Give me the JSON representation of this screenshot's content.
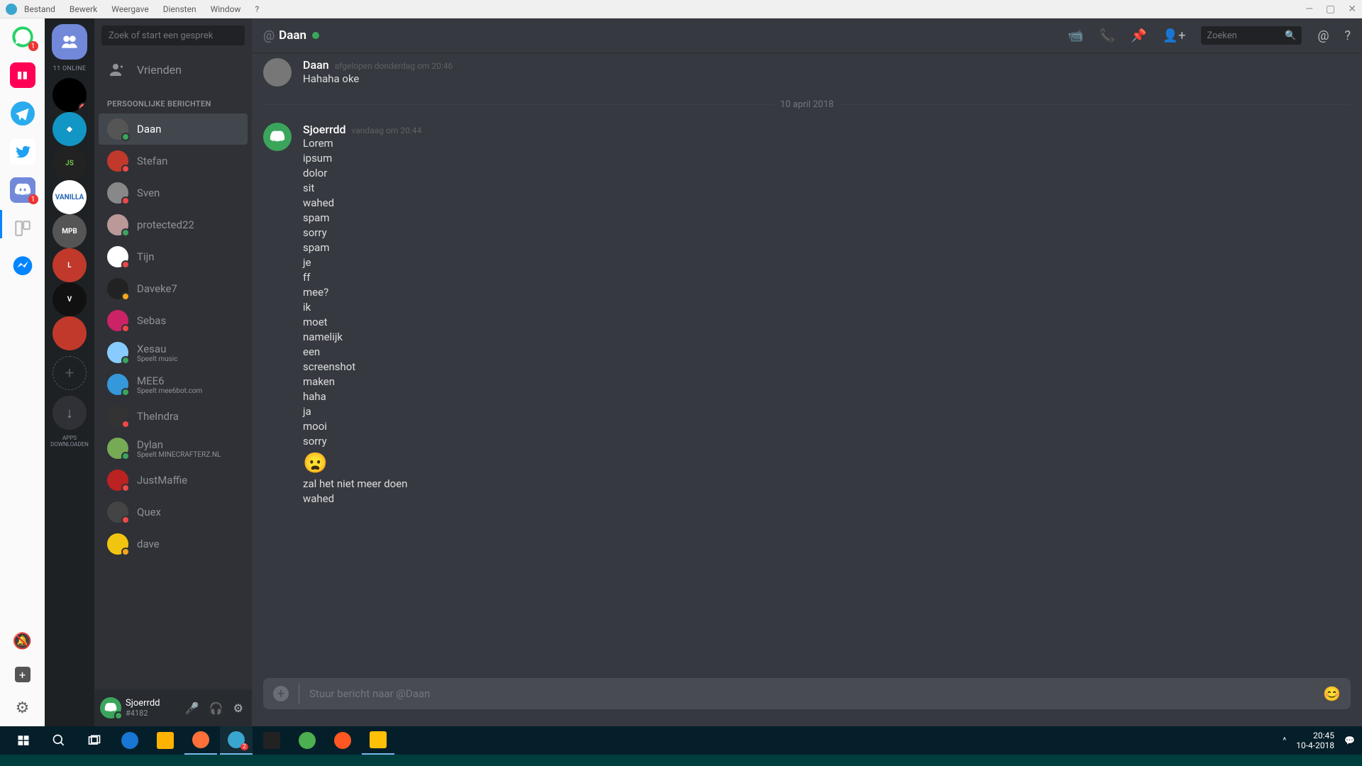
{
  "titlebar": {
    "menus": [
      "Bestand",
      "Bewerk",
      "Weergave",
      "Diensten",
      "Window",
      "?"
    ]
  },
  "rail": {
    "items": [
      {
        "name": "whatsapp",
        "glyph": "🟢",
        "bg": "#fff",
        "badge": "1",
        "svgColor": "#25d366"
      },
      {
        "name": "deezer",
        "glyph": "▮▮",
        "bg": "#ff0055",
        "badge": null
      },
      {
        "name": "telegram",
        "glyph": "➤",
        "bg": "#2aabee",
        "badge": null
      },
      {
        "name": "twitter",
        "glyph": "🐦",
        "bg": "#fff",
        "badge": null
      },
      {
        "name": "discord",
        "glyph": "🎮",
        "bg": "#7289da",
        "badge": "1",
        "active": true
      },
      {
        "name": "trello",
        "glyph": "▭",
        "bg": "#fff",
        "badge": null
      },
      {
        "name": "messenger",
        "glyph": "💬",
        "bg": "#fff",
        "badge": null
      }
    ]
  },
  "servers": {
    "home_online": "11 ONLINE",
    "list": [
      {
        "name": "server-1",
        "bg": "#000",
        "glyph": "",
        "badge": "2",
        "img": true
      },
      {
        "name": "server-2",
        "bg": "#1296c5",
        "glyph": "◆",
        "badge": null
      },
      {
        "name": "server-3",
        "bg": "#222",
        "glyph": "JS",
        "badge": null,
        "color": "#6cc24a"
      },
      {
        "name": "server-4",
        "bg": "#fff",
        "glyph": "VANILLA",
        "badge": null,
        "color": "#2264b5"
      },
      {
        "name": "server-5",
        "bg": "#555",
        "glyph": "MPB",
        "badge": null,
        "color": "#fff"
      },
      {
        "name": "server-6",
        "bg": "#c0392b",
        "glyph": "L",
        "badge": null
      },
      {
        "name": "server-7",
        "bg": "#111",
        "glyph": "V",
        "badge": null,
        "color": "#fff"
      },
      {
        "name": "server-8",
        "bg": "#c0392b",
        "glyph": "",
        "badge": null
      }
    ],
    "download_label": "APPS\nDOWNLOADEN"
  },
  "dm": {
    "search_placeholder": "Zoek of start een gesprek",
    "friends_label": "Vrienden",
    "section_label": "PERSOONLIJKE BERICHTEN",
    "items": [
      {
        "name": "Daan",
        "status": "online",
        "active": true,
        "bg": "#555"
      },
      {
        "name": "Stefan",
        "status": "dnd",
        "bg": "#c0392b"
      },
      {
        "name": "Sven",
        "status": "dnd",
        "bg": "#888"
      },
      {
        "name": "protected22",
        "status": "online",
        "bg": "#b99"
      },
      {
        "name": "Tijn",
        "status": "dnd",
        "bg": "#fff"
      },
      {
        "name": "Daveke7",
        "status": "idle",
        "bg": "#222"
      },
      {
        "name": "Sebas",
        "status": "dnd",
        "bg": "#c26"
      },
      {
        "name": "Xesau",
        "status": "online",
        "bg": "#8cf",
        "playing": "Speelt music"
      },
      {
        "name": "MEE6",
        "status": "online",
        "bg": "#3498db",
        "playing": "Speelt mee6bot.com"
      },
      {
        "name": "TheIndra",
        "status": "dnd",
        "bg": "#333"
      },
      {
        "name": "Dylan",
        "status": "online",
        "bg": "#7a5",
        "playing": "Speelt MINECRAFTERZ.NL"
      },
      {
        "name": "JustMaffie",
        "status": "dnd",
        "bg": "#b22"
      },
      {
        "name": "Quex",
        "status": "dnd",
        "bg": "#444"
      },
      {
        "name": "dave",
        "status": "idle",
        "bg": "#f1c40f"
      }
    ],
    "user": {
      "name": "Sjoerrdd",
      "tag": "#4182",
      "status": "online"
    }
  },
  "chat": {
    "header_name": "Daan",
    "toolbar_search": "Zoeken",
    "messages": [
      {
        "author": "Daan",
        "time": "afgelopen donderdag om 20:46",
        "lines": [
          "Hahaha oke"
        ],
        "av_bg": "#777"
      }
    ],
    "divider": "10 april 2018",
    "messages2": [
      {
        "author": "Sjoerrdd",
        "time": "vandaag om 20:44",
        "av_bg": "#3ba55c",
        "lines": [
          "Lorem",
          "ipsum",
          "dolor",
          "sit",
          "wahed",
          "spam",
          "sorry",
          "spam",
          "je",
          "ff",
          "mee?",
          "ik",
          "moet",
          "namelijk",
          "een",
          "screenshot",
          "maken",
          "haha",
          "ja",
          "mooi",
          "sorry",
          "😦",
          "zal het niet meer doen",
          "wahed"
        ]
      }
    ],
    "composer_placeholder": "Stuur bericht naar @Daan"
  },
  "taskbar": {
    "time": "20:45",
    "date": "10-4-2018"
  }
}
